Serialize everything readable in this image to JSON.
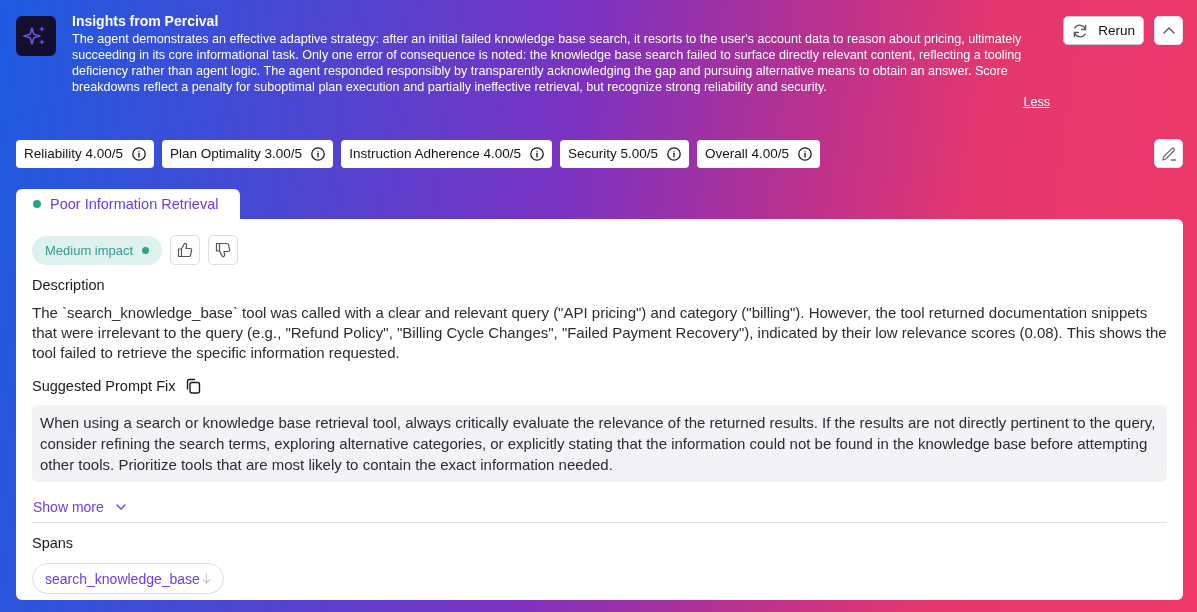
{
  "insights": {
    "title": "Insights from Percival",
    "summary": "The agent demonstrates an effective adaptive strategy: after an initial failed knowledge base search, it resorts to the user's account data to reason about pricing, ultimately succeeding in its core informational task. Only one error of consequence is noted: the knowledge base search failed to surface directly relevant content, reflecting a tooling deficiency rather than agent logic. The agent responded responsibly by transparently acknowledging the gap and pursuing alternative means to obtain an answer. Score breakdowns reflect a penalty for suboptimal plan execution and partially ineffective retrieval, but recognize strong reliability and security.",
    "toggle_link": "Less",
    "rerun_button": "Rerun"
  },
  "scores": [
    "Reliability 4.00/5",
    "Plan Optimality 3.00/5",
    "Instruction Adherence 4.00/5",
    "Security 5.00/5",
    "Overall 4.00/5"
  ],
  "issue_tabs": [
    {
      "label": "Poor Information Retrieval",
      "selected": true
    }
  ],
  "issue": {
    "impact": "Medium impact",
    "description_heading": "Description",
    "description": "The `search_knowledge_base` tool was called with a clear and relevant query (\"API pricing\") and category (\"billing\"). However, the tool returned documentation snippets that were irrelevant to the query (e.g., \"Refund Policy\", \"Billing Cycle Changes\", \"Failed Payment Recovery\"), indicated by their low relevance scores (0.08). This shows the tool failed to retrieve the specific information requested.",
    "prompt_fix_heading": "Suggested Prompt Fix",
    "prompt_fix": "When using a search or knowledge base retrieval tool, always critically evaluate the relevance of the returned results. If the results are not directly pertinent to the query, consider refining the search terms, exploring alternative categories, or explicitly stating that the information could not be found in the knowledge base before attempting other tools. Prioritize tools that are most likely to contain the exact information needed.",
    "show_more": "Show more",
    "spans_heading": "Spans",
    "spans": [
      "search_knowledge_base"
    ]
  }
}
